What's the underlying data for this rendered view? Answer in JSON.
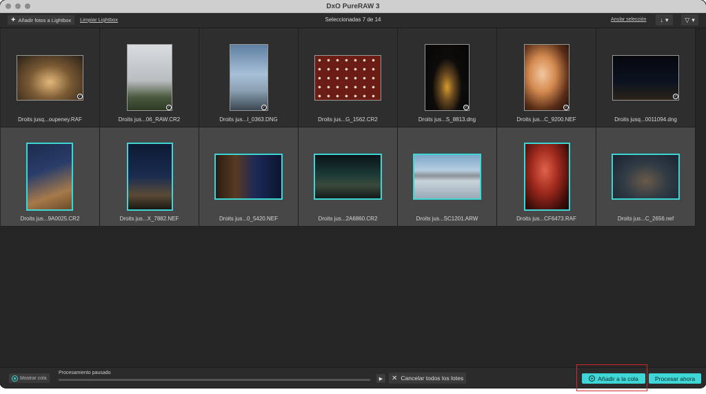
{
  "window": {
    "title": "DxO PureRAW 3"
  },
  "toolbar": {
    "add_photos_label": "Añadir fotos a Lightbox",
    "clear_lightbox_label": "Limpiar Lightbox",
    "selection_count": "Seleccionadas 7 de 14",
    "undo_selection_label": "Anular selección",
    "sort_glyph": "↓",
    "filter_glyph": "▽"
  },
  "photos": [
    {
      "name": "Droits jusq...oupeney.RAF",
      "selected": false
    },
    {
      "name": "Droits jus...06_RAW.CR2",
      "selected": false
    },
    {
      "name": "Droits jus...I_0363.DNG",
      "selected": false
    },
    {
      "name": "Droits jus...G_1562.CR2",
      "selected": false
    },
    {
      "name": "Droits jus...S_8813.dng",
      "selected": false
    },
    {
      "name": "Droits jus...C_9200.NEF",
      "selected": false
    },
    {
      "name": "Droits jusq...0011094.dng",
      "selected": false
    },
    {
      "name": "Droits jus...9A0025.CR2",
      "selected": true
    },
    {
      "name": "Droits jus...X_7882.NEF",
      "selected": true
    },
    {
      "name": "Droits jus...0_5420.NEF",
      "selected": true
    },
    {
      "name": "Droits jus...2A6860.CR2",
      "selected": true
    },
    {
      "name": "Droits jus...SC1201.ARW",
      "selected": true
    },
    {
      "name": "Droits jus...CF6473.RAF",
      "selected": true
    },
    {
      "name": "Droits jus...C_2656.nef",
      "selected": true
    }
  ],
  "bottom": {
    "show_queue_label": "Mostrar cola",
    "processing_status": "Procesamiento pausado",
    "progress_percent": 0,
    "cancel_all_label": "Cancelar todos los lotes",
    "add_to_queue_label": "Añadir a la cola",
    "process_now_label": "Procesar ahora"
  },
  "colors": {
    "accent": "#3ed6d6",
    "highlight": "#d8262e"
  }
}
